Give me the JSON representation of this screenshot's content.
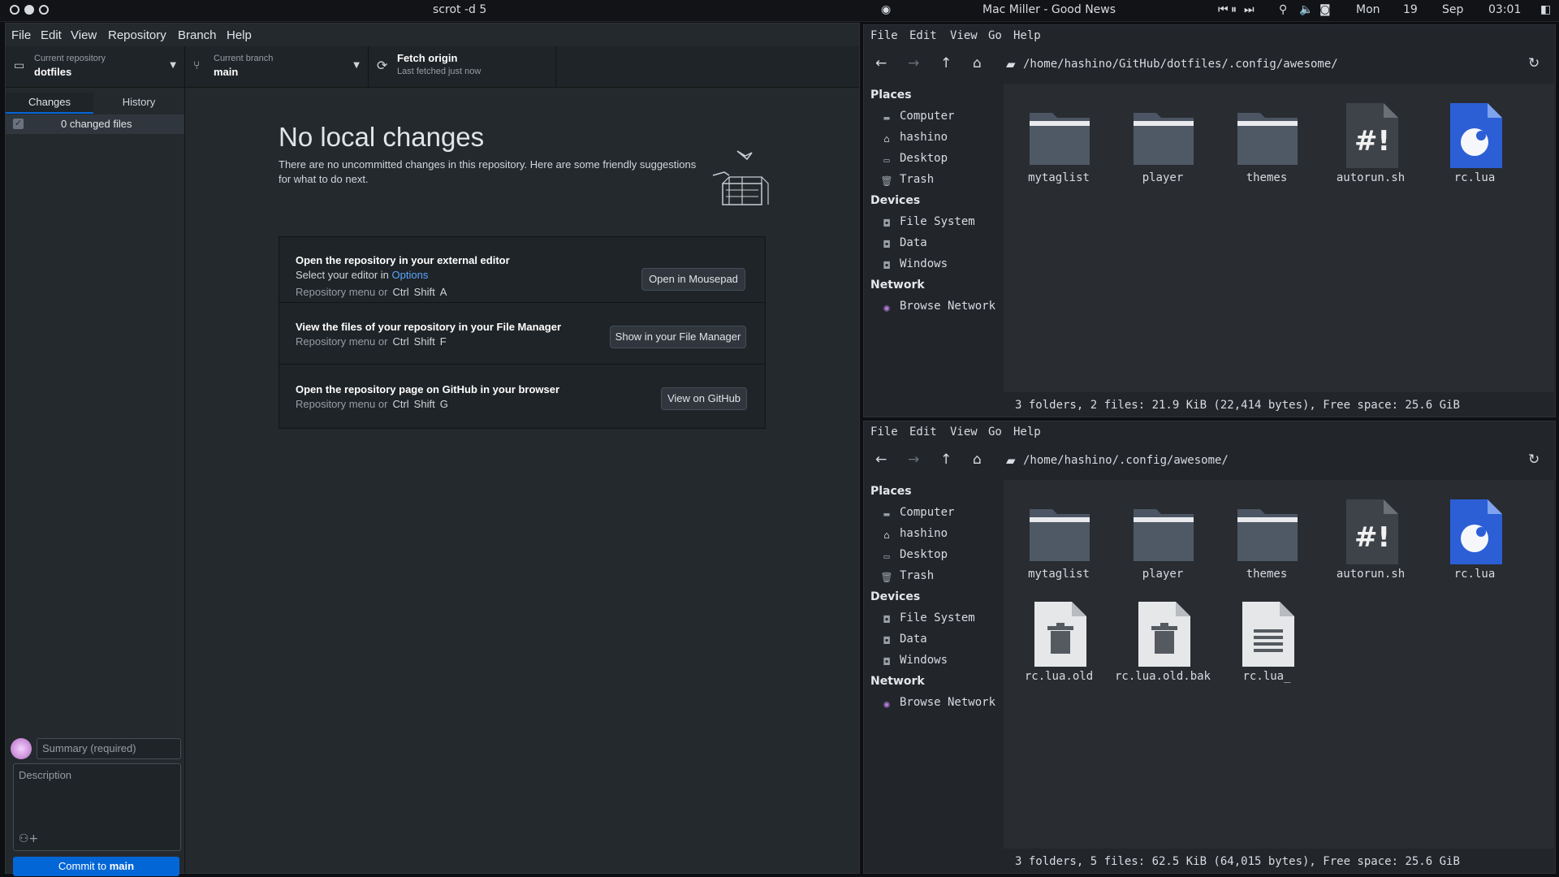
{
  "topbar": {
    "window_title": "scrot -d 5",
    "now_playing": "Mac Miller - Good News",
    "day": "Mon",
    "date": "19",
    "month": "Sep",
    "time": "03:01"
  },
  "github": {
    "menu": [
      "File",
      "Edit",
      "View",
      "Repository",
      "Branch",
      "Help"
    ],
    "repo_label": "Current repository",
    "repo_value": "dotfiles",
    "branch_label": "Current branch",
    "branch_value": "main",
    "fetch_label": "Fetch origin",
    "fetch_sub": "Last fetched just now",
    "tabs": [
      "Changes",
      "History"
    ],
    "changed_files": "0 changed files",
    "summary_placeholder": "Summary (required)",
    "description_placeholder": "Description",
    "commit_prefix": "Commit to",
    "commit_branch": "main",
    "heading": "No local changes",
    "intro": "There are no uncommitted changes in this repository. Here are some friendly suggestions for what to do next.",
    "cards": [
      {
        "title": "Open the repository in your external editor",
        "sub_prefix": "Select your editor in",
        "sub_link": "Options",
        "shortcut_prefix": "Repository menu or",
        "keys": [
          "Ctrl",
          "Shift",
          "A"
        ],
        "button": "Open in Mousepad"
      },
      {
        "title": "View the files of your repository in your File Manager",
        "shortcut_prefix": "Repository menu or",
        "keys": [
          "Ctrl",
          "Shift",
          "F"
        ],
        "button": "Show in your File Manager"
      },
      {
        "title": "Open the repository page on GitHub in your browser",
        "shortcut_prefix": "Repository menu or",
        "keys": [
          "Ctrl",
          "Shift",
          "G"
        ],
        "button": "View on GitHub"
      }
    ]
  },
  "fm_common": {
    "menu": [
      "File",
      "Edit",
      "View",
      "Go",
      "Help"
    ],
    "places_header": "Places",
    "places": [
      "Computer",
      "hashino",
      "Desktop",
      "Trash"
    ],
    "devices_header": "Devices",
    "devices": [
      "File System",
      "Data",
      "Windows"
    ],
    "network_header": "Network",
    "network": [
      "Browse Network"
    ]
  },
  "fm_top": {
    "path": "/home/hashino/GitHub/dotfiles/.config/awesome/",
    "files": [
      "mytaglist",
      "player",
      "themes",
      "autorun.sh",
      "rc.lua"
    ],
    "status": "3 folders, 2 files: 21.9 KiB (22,414 bytes), Free space: 25.6 GiB"
  },
  "fm_bottom": {
    "path": "/home/hashino/.config/awesome/",
    "files": [
      "mytaglist",
      "player",
      "themes",
      "autorun.sh",
      "rc.lua",
      "rc.lua.old",
      "rc.lua.old.bak",
      "rc.lua_"
    ],
    "status": "3 folders, 5 files: 62.5 KiB (64,015 bytes), Free space: 25.6 GiB"
  },
  "colors": {
    "accent": "#0366d6",
    "link": "#58a6ff",
    "lua": "#2c5fd6"
  }
}
